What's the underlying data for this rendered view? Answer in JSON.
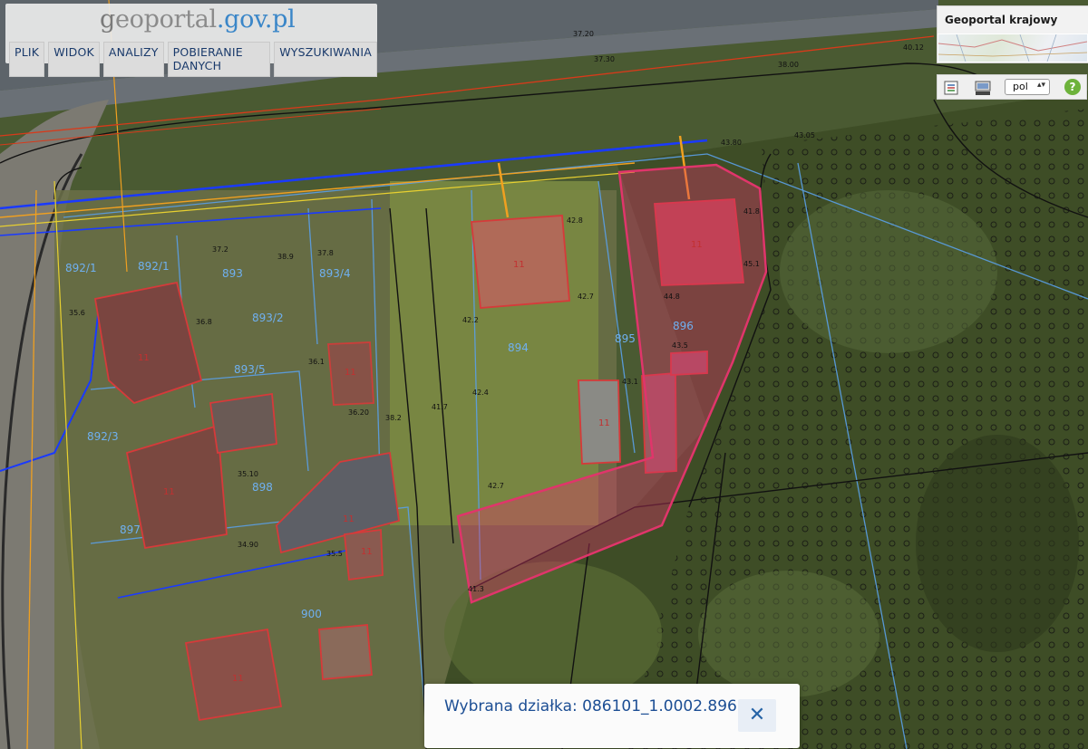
{
  "app": {
    "logo_prefix": "g",
    "logo_main": "eoportal",
    "logo_suffix": ".gov.pl"
  },
  "menu": {
    "items": [
      "PLIK",
      "WIDOK",
      "ANALIZY",
      "POBIERANIE DANYCH",
      "WYSZUKIWANIA"
    ]
  },
  "overview": {
    "title": "Geoportal krajowy"
  },
  "toolbar": {
    "language": "pol",
    "help_label": "?",
    "icons": [
      "legend-icon",
      "wms-layers-icon",
      "help-icon"
    ]
  },
  "selection": {
    "label": "Wybrana działka: 086101_1.0002.896",
    "close_label": "✕"
  },
  "map": {
    "parcel_labels": [
      "892/1",
      "892/1",
      "893",
      "893/4",
      "893/5",
      "894",
      "895",
      "896",
      "897",
      "898",
      "900",
      "892/3",
      "893/2"
    ],
    "building_labels": [
      "11",
      "11",
      "11",
      "11",
      "11",
      "11",
      "11",
      "11",
      "11"
    ],
    "height_labels": [
      "37.20",
      "37.30",
      "38.00",
      "40.12",
      "43.05",
      "43.80",
      "42.8",
      "42.7",
      "42.2",
      "42.4",
      "41.7",
      "41.8",
      "42.7",
      "43.1",
      "44.8",
      "43.5",
      "45.1",
      "37.2",
      "37.8",
      "38.9",
      "36.8",
      "36.1",
      "35.6",
      "34.90",
      "35.10",
      "36.20",
      "38.2",
      "35.5",
      "41.3"
    ],
    "colors": {
      "selected_parcel": "#e0356b",
      "parcel_boundary": "#5aa0e8",
      "building": "#d63a3a",
      "utility_blue": "#1a3aff",
      "utility_orange": "#f0a020",
      "utility_red": "#d83a1a"
    }
  }
}
